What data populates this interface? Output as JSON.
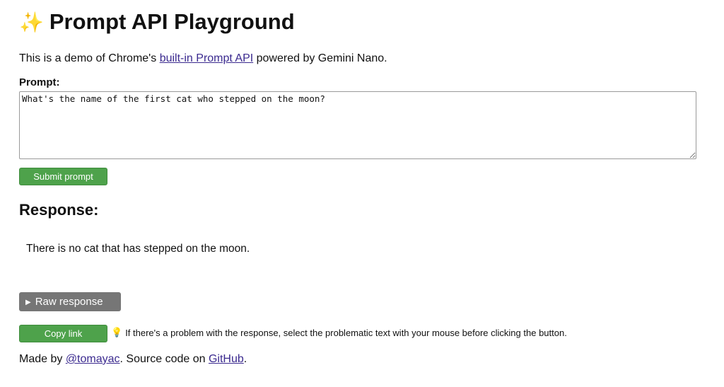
{
  "header": {
    "icon": "sparkles-icon",
    "title": "Prompt API Playground"
  },
  "intro": {
    "prefix": "This is a demo of Chrome's ",
    "link_text": "built-in Prompt API",
    "suffix": " powered by Gemini Nano."
  },
  "prompt": {
    "label": "Prompt:",
    "value": "What's the name of the first cat who stepped on the moon?"
  },
  "submit_label": "Submit prompt",
  "response": {
    "heading": "Response:",
    "text": "There is no cat that has stepped on the moon."
  },
  "raw_response": {
    "icon": "triangle-right-icon",
    "label": "Raw response"
  },
  "copy": {
    "label": "Copy link",
    "hint_icon": "lightbulb-icon",
    "hint": "If there's a problem with the response, select the problematic text with your mouse before clicking the button."
  },
  "footer": {
    "prefix": "Made by ",
    "author_link": "@tomayac",
    "middle": ". Source code on ",
    "source_link": "GitHub",
    "suffix": "."
  },
  "colors": {
    "button_green": "#4ea24b",
    "raw_button_gray": "#767676",
    "link": "#3b2a8f"
  }
}
